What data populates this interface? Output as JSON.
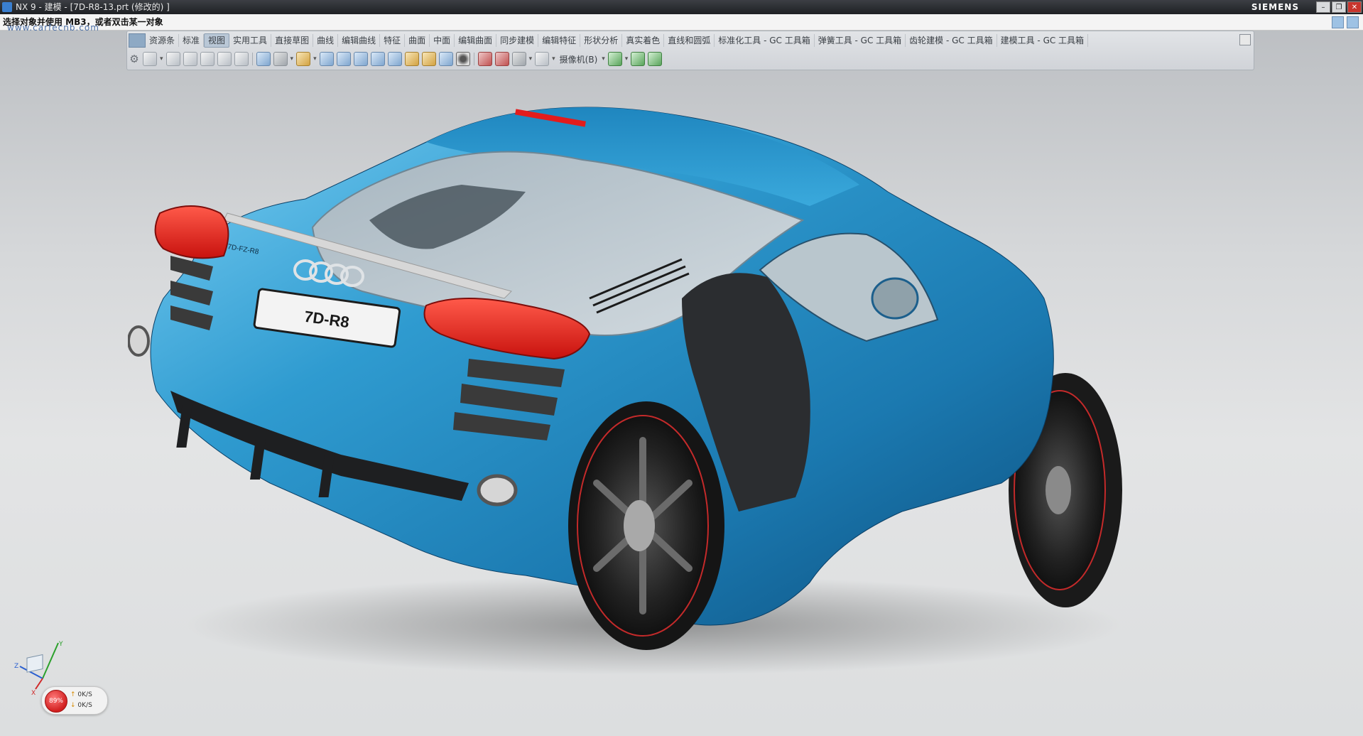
{
  "window": {
    "title": "NX 9 - 建模 - [7D-R8-13.prt (修改的) ]",
    "brand": "SIEMENS",
    "controls": [
      "–",
      "❐",
      "✕"
    ]
  },
  "status": {
    "prompt": "选择对象并使用 MB3，或者双击某一对象",
    "watermark": "www.carfecnb.com"
  },
  "toolbar": {
    "tabs": [
      "资源条",
      "标准",
      "视图",
      "实用工具",
      "直接草图",
      "曲线",
      "编辑曲线",
      "特征",
      "曲面",
      "中面",
      "编辑曲面",
      "同步建模",
      "编辑特征",
      "形状分析",
      "真实着色",
      "直线和圆弧",
      "标准化工具 - GC 工具箱",
      "弹簧工具 - GC 工具箱",
      "齿轮建模 - GC 工具箱",
      "建模工具 - GC 工具箱"
    ],
    "active_tab": "视图",
    "camera_label": "摄像机(B)"
  },
  "car": {
    "license_plate": "7D-R8",
    "badge": "7D-FZ-R8",
    "body_color": "#2f9bd0",
    "light_color": "#e31c1c"
  },
  "triad": {
    "x": "X",
    "y": "Y",
    "z": "Z"
  },
  "performance": {
    "percent": "89%",
    "up": "0K/S",
    "down": "0K/S"
  }
}
